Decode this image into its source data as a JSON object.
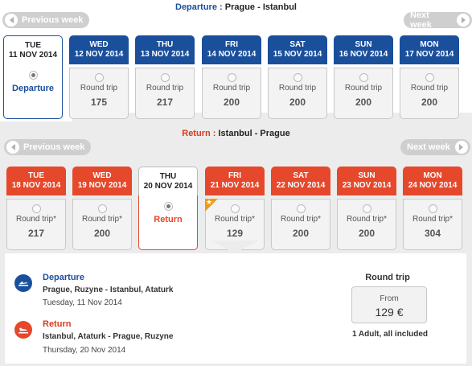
{
  "departure_header": {
    "label": "Departure :",
    "route": "Prague - Istanbul"
  },
  "return_header": {
    "label": "Return :",
    "route": "Istanbul - Prague"
  },
  "nav": {
    "prev": "Previous week",
    "next": "Next week"
  },
  "departure_days": [
    {
      "dow": "TUE",
      "date": "11 NOV 2014",
      "selected": true,
      "label": "Departure"
    },
    {
      "dow": "WED",
      "date": "12 NOV 2014",
      "rt": "Round trip",
      "price": "175"
    },
    {
      "dow": "THU",
      "date": "13 NOV 2014",
      "rt": "Round trip",
      "price": "217"
    },
    {
      "dow": "FRI",
      "date": "14 NOV 2014",
      "rt": "Round trip",
      "price": "200"
    },
    {
      "dow": "SAT",
      "date": "15 NOV 2014",
      "rt": "Round trip",
      "price": "200"
    },
    {
      "dow": "SUN",
      "date": "16 NOV 2014",
      "rt": "Round trip",
      "price": "200"
    },
    {
      "dow": "MON",
      "date": "17 NOV 2014",
      "rt": "Round trip",
      "price": "200"
    }
  ],
  "return_days": [
    {
      "dow": "TUE",
      "date": "18 NOV 2014",
      "rt": "Round trip*",
      "price": "217"
    },
    {
      "dow": "WED",
      "date": "19 NOV 2014",
      "rt": "Round trip*",
      "price": "200"
    },
    {
      "dow": "THU",
      "date": "20 NOV 2014",
      "selected": true,
      "label": "Return"
    },
    {
      "dow": "FRI",
      "date": "21 NOV 2014",
      "rt": "Round trip*",
      "price": "129",
      "badge": "star-icon"
    },
    {
      "dow": "SAT",
      "date": "22 NOV 2014",
      "rt": "Round trip*",
      "price": "200"
    },
    {
      "dow": "SUN",
      "date": "23 NOV 2014",
      "rt": "Round trip*",
      "price": "200"
    },
    {
      "dow": "MON",
      "date": "24 NOV 2014",
      "rt": "Round trip*",
      "price": "304"
    }
  ],
  "summary": {
    "departure": {
      "title": "Departure",
      "route": "Prague, Ruzyne - Istanbul, Ataturk",
      "date": "Tuesday, 11 Nov 2014",
      "icon": "plane-takeoff-icon"
    },
    "return": {
      "title": "Return",
      "route": "Istanbul, Ataturk - Prague, Ruzyne",
      "date": "Thursday, 20 Nov 2014",
      "icon": "plane-landing-icon"
    },
    "fare": {
      "title": "Round trip",
      "from": "From",
      "price": "129 €",
      "note": "1 Adult, all included"
    }
  },
  "colors": {
    "departure": "#1a4f9c",
    "return": "#e5482b",
    "badge": "#f29a14"
  }
}
